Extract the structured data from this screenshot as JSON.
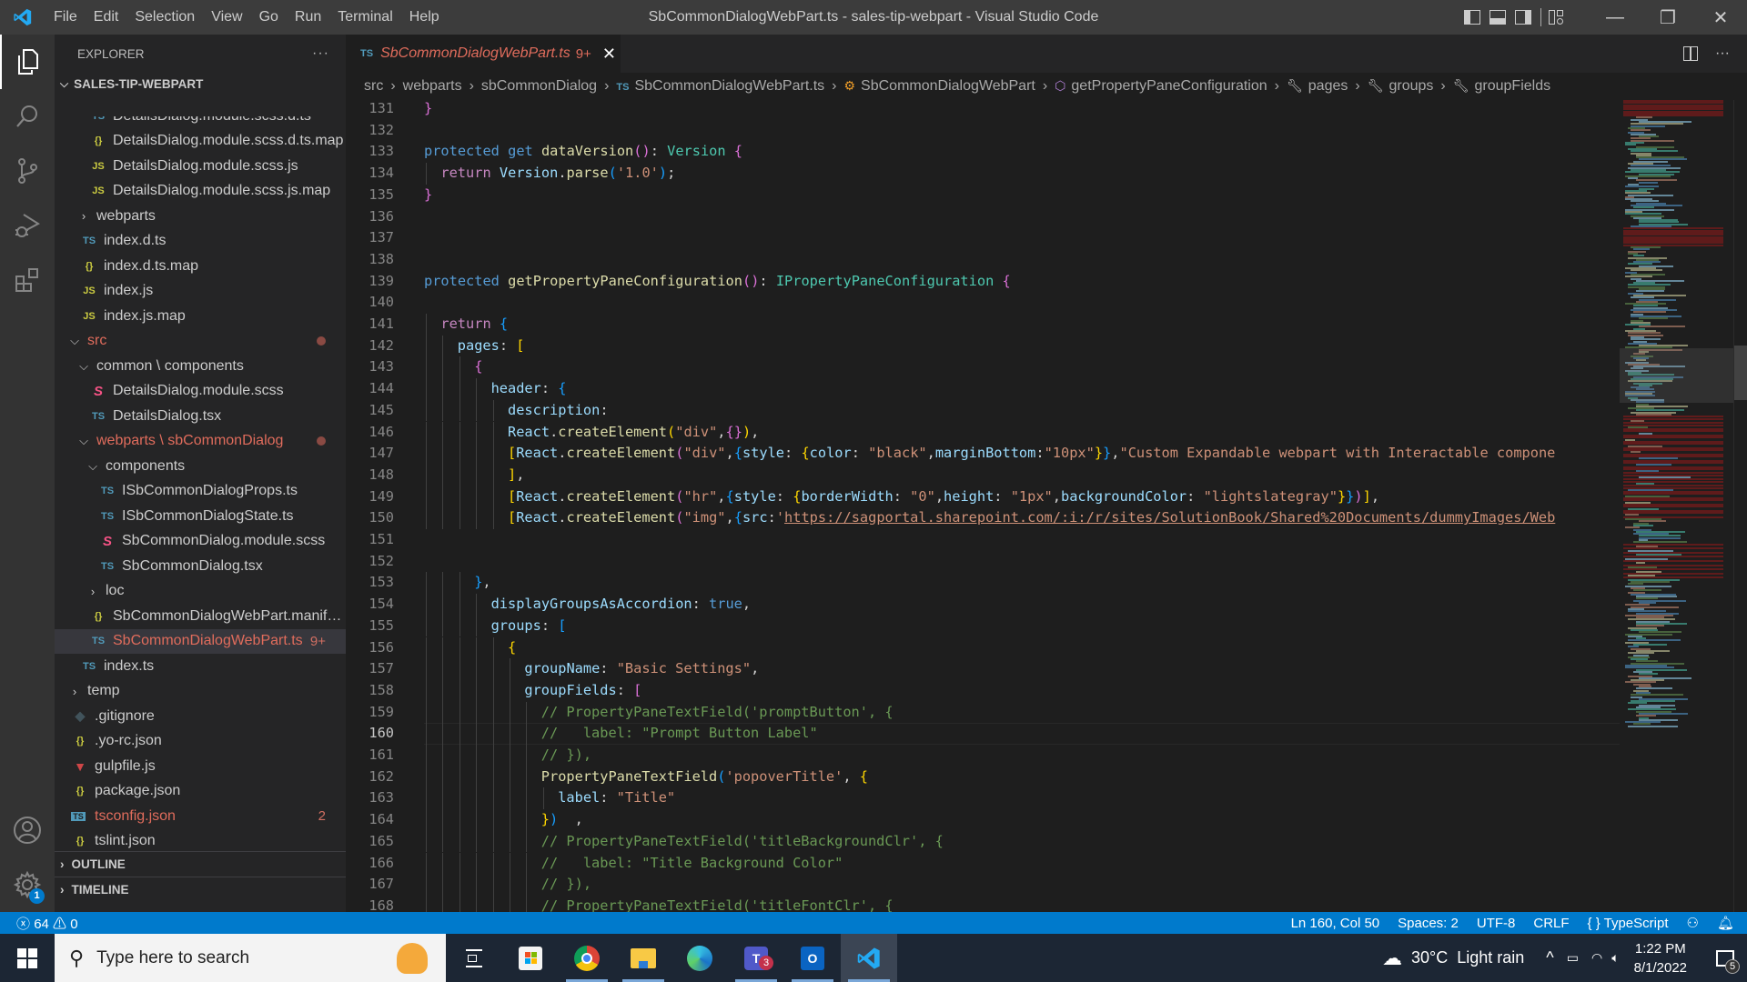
{
  "titlebar": {
    "menu": [
      "File",
      "Edit",
      "Selection",
      "View",
      "Go",
      "Run",
      "Terminal",
      "Help"
    ],
    "title": "SbCommonDialogWebPart.ts - sales-tip-webpart - Visual Studio Code",
    "controls": {
      "minimize": "—",
      "restore": "❐",
      "close": "✕"
    }
  },
  "activity_bar": {
    "items": [
      "explorer-icon",
      "search-icon",
      "source-control-icon",
      "run-debug-icon",
      "extensions-icon"
    ],
    "bottom": [
      "accounts-icon",
      "manage-gear-icon"
    ],
    "manage_badge": "1"
  },
  "sidebar": {
    "header": "EXPLORER",
    "more": "···",
    "project": "SALES-TIP-WEBPART",
    "tree": [
      {
        "label": "DetailsDialog.module.scss.d.ts",
        "icon": "TS",
        "kind": "ts",
        "depth": 3,
        "partial": true
      },
      {
        "label": "DetailsDialog.module.scss.d.ts.map",
        "icon": "{}",
        "kind": "json",
        "depth": 3
      },
      {
        "label": "DetailsDialog.module.scss.js",
        "icon": "JS",
        "kind": "js",
        "depth": 3
      },
      {
        "label": "DetailsDialog.module.scss.js.map",
        "icon": "JS",
        "kind": "js",
        "depth": 3
      },
      {
        "label": "webparts",
        "folder": "closed",
        "depth": 2
      },
      {
        "label": "index.d.ts",
        "icon": "TS",
        "kind": "ts",
        "depth": 2
      },
      {
        "label": "index.d.ts.map",
        "icon": "{}",
        "kind": "json",
        "depth": 2
      },
      {
        "label": "index.js",
        "icon": "JS",
        "kind": "js",
        "depth": 2
      },
      {
        "label": "index.js.map",
        "icon": "JS",
        "kind": "js",
        "depth": 2
      },
      {
        "label": "src",
        "folder": "open",
        "depth": 1,
        "modified": true,
        "dot": true
      },
      {
        "label": "common \\ components",
        "folder": "open",
        "depth": 2
      },
      {
        "label": "DetailsDialog.module.scss",
        "icon": "S",
        "kind": "scss",
        "depth": 3
      },
      {
        "label": "DetailsDialog.tsx",
        "icon": "TS",
        "kind": "ts",
        "depth": 3
      },
      {
        "label": "webparts \\ sbCommonDialog",
        "folder": "open",
        "depth": 2,
        "modified": true,
        "dot": true
      },
      {
        "label": "components",
        "folder": "open",
        "depth": 3
      },
      {
        "label": "ISbCommonDialogProps.ts",
        "icon": "TS",
        "kind": "ts",
        "depth": 4
      },
      {
        "label": "ISbCommonDialogState.ts",
        "icon": "TS",
        "kind": "ts",
        "depth": 4
      },
      {
        "label": "SbCommonDialog.module.scss",
        "icon": "S",
        "kind": "scss",
        "depth": 4
      },
      {
        "label": "SbCommonDialog.tsx",
        "icon": "TS",
        "kind": "ts",
        "depth": 4
      },
      {
        "label": "loc",
        "folder": "closed",
        "depth": 3
      },
      {
        "label": "SbCommonDialogWebPart.manife...",
        "icon": "{}",
        "kind": "json",
        "depth": 3
      },
      {
        "label": "SbCommonDialogWebPart.ts",
        "icon": "TS",
        "kind": "ts",
        "depth": 3,
        "modified": true,
        "selected": true,
        "badge": "9+"
      },
      {
        "label": "index.ts",
        "icon": "TS",
        "kind": "ts",
        "depth": 2
      },
      {
        "label": "temp",
        "folder": "closed",
        "depth": 1
      },
      {
        "label": ".gitignore",
        "icon": "◆",
        "kind": "git",
        "depth": 1
      },
      {
        "label": ".yo-rc.json",
        "icon": "{}",
        "kind": "json",
        "depth": 1
      },
      {
        "label": "gulpfile.js",
        "icon": "▼",
        "kind": "gulp",
        "depth": 1
      },
      {
        "label": "package.json",
        "icon": "{}",
        "kind": "json",
        "depth": 1
      },
      {
        "label": "tsconfig.json",
        "icon": "TS",
        "kind": "tsconfig",
        "depth": 1,
        "modified": true,
        "badge": "2"
      },
      {
        "label": "tslint.json",
        "icon": "{}",
        "kind": "json",
        "depth": 1
      }
    ],
    "sections": [
      "OUTLINE",
      "TIMELINE"
    ]
  },
  "tabs": [
    {
      "icon": "TS",
      "label": "SbCommonDialogWebPart.ts",
      "problems": "9+",
      "close": "✕",
      "active": true
    }
  ],
  "breadcrumb": [
    {
      "label": "src"
    },
    {
      "label": "webparts"
    },
    {
      "label": "sbCommonDialog"
    },
    {
      "label": "SbCommonDialogWebPart.ts",
      "icon": "TS"
    },
    {
      "label": "SbCommonDialogWebPart",
      "icon": "class-icon"
    },
    {
      "label": "getPropertyPaneConfiguration",
      "icon": "method-icon"
    },
    {
      "label": "pages",
      "icon": "property-icon"
    },
    {
      "label": "groups",
      "icon": "property-icon"
    },
    {
      "label": "groupFields",
      "icon": "property-icon"
    }
  ],
  "editor": {
    "current_line": 160,
    "lines": [
      {
        "n": "131",
        "indent": 1,
        "tokens": [
          [
            "b1",
            "}"
          ]
        ]
      },
      {
        "n": "132",
        "indent": 0,
        "tokens": []
      },
      {
        "n": "133",
        "indent": 1,
        "tokens": [
          [
            "kw",
            "protected "
          ],
          [
            "kw",
            "get "
          ],
          [
            "fn",
            "dataVersion"
          ],
          [
            "b1",
            "()"
          ],
          [
            "d",
            ": "
          ],
          [
            "ty",
            "Version "
          ],
          [
            "b1",
            "{"
          ]
        ]
      },
      {
        "n": "134",
        "indent": 2,
        "tokens": [
          [
            "kw2",
            "return "
          ],
          [
            "pr",
            "Version"
          ],
          [
            "d",
            "."
          ],
          [
            "fn",
            "parse"
          ],
          [
            "b2",
            "("
          ],
          [
            "st",
            "'1.0'"
          ],
          [
            "b2",
            ")"
          ],
          [
            "d",
            ";"
          ]
        ]
      },
      {
        "n": "135",
        "indent": 1,
        "tokens": [
          [
            "b1",
            "}"
          ]
        ]
      },
      {
        "n": "136",
        "indent": 0,
        "tokens": []
      },
      {
        "n": "137",
        "indent": 0,
        "tokens": []
      },
      {
        "n": "138",
        "indent": 0,
        "tokens": []
      },
      {
        "n": "139",
        "indent": 1,
        "tokens": [
          [
            "kw",
            "protected "
          ],
          [
            "fn",
            "getPropertyPaneConfiguration"
          ],
          [
            "b1",
            "()"
          ],
          [
            "d",
            ": "
          ],
          [
            "ty",
            "IPropertyPaneConfiguration "
          ],
          [
            "b1",
            "{"
          ]
        ]
      },
      {
        "n": "140",
        "indent": 0,
        "tokens": []
      },
      {
        "n": "141",
        "indent": 2,
        "tokens": [
          [
            "kw2",
            "return "
          ],
          [
            "b2",
            "{"
          ]
        ]
      },
      {
        "n": "142",
        "indent": 3,
        "tokens": [
          [
            "pr",
            "pages"
          ],
          [
            "d",
            ": "
          ],
          [
            "b3",
            "["
          ]
        ]
      },
      {
        "n": "143",
        "indent": 4,
        "tokens": [
          [
            "b1",
            "{"
          ]
        ]
      },
      {
        "n": "144",
        "indent": 5,
        "tokens": [
          [
            "pr",
            "header"
          ],
          [
            "d",
            ": "
          ],
          [
            "b2",
            "{"
          ]
        ]
      },
      {
        "n": "145",
        "indent": 6,
        "tokens": [
          [
            "pr",
            "description"
          ],
          [
            "d",
            ":"
          ]
        ]
      },
      {
        "n": "146",
        "indent": 6,
        "tokens": [
          [
            "pr",
            "React"
          ],
          [
            "d",
            "."
          ],
          [
            "fn",
            "createElement"
          ],
          [
            "b3",
            "("
          ],
          [
            "st",
            "\"div\""
          ],
          [
            "d",
            ","
          ],
          [
            "b1",
            "{}"
          ],
          [
            "b3",
            ")"
          ],
          [
            "d",
            ","
          ]
        ]
      },
      {
        "n": "147",
        "indent": 6,
        "tokens": [
          [
            "b3",
            "["
          ],
          [
            "pr",
            "React"
          ],
          [
            "d",
            "."
          ],
          [
            "fn",
            "createElement"
          ],
          [
            "b1",
            "("
          ],
          [
            "st",
            "\"div\""
          ],
          [
            "d",
            ","
          ],
          [
            "b2",
            "{"
          ],
          [
            "pr",
            "style"
          ],
          [
            "d",
            ": "
          ],
          [
            "b3",
            "{"
          ],
          [
            "pr",
            "color"
          ],
          [
            "d",
            ": "
          ],
          [
            "st",
            "\"black\""
          ],
          [
            "d",
            ","
          ],
          [
            "pr",
            "marginBottom"
          ],
          [
            "d",
            ":"
          ],
          [
            "st",
            "\"10px\""
          ],
          [
            "b3",
            "}"
          ],
          [
            "b2",
            "}"
          ],
          [
            "d",
            ","
          ],
          [
            "st",
            "\"Custom Expandable webpart with Interactable compone"
          ]
        ]
      },
      {
        "n": "148",
        "indent": 6,
        "tokens": [
          [
            "b3",
            "]"
          ],
          [
            "d",
            ","
          ]
        ]
      },
      {
        "n": "149",
        "indent": 6,
        "tokens": [
          [
            "b3",
            "["
          ],
          [
            "pr",
            "React"
          ],
          [
            "d",
            "."
          ],
          [
            "fn",
            "createElement"
          ],
          [
            "b1",
            "("
          ],
          [
            "st",
            "\"hr\""
          ],
          [
            "d",
            ","
          ],
          [
            "b2",
            "{"
          ],
          [
            "pr",
            "style"
          ],
          [
            "d",
            ": "
          ],
          [
            "b3",
            "{"
          ],
          [
            "pr",
            "borderWidth"
          ],
          [
            "d",
            ": "
          ],
          [
            "st",
            "\"0\""
          ],
          [
            "d",
            ","
          ],
          [
            "pr",
            "height"
          ],
          [
            "d",
            ": "
          ],
          [
            "st",
            "\"1px\""
          ],
          [
            "d",
            ","
          ],
          [
            "pr",
            "backgroundColor"
          ],
          [
            "d",
            ": "
          ],
          [
            "st",
            "\"lightslategray\""
          ],
          [
            "b3",
            "}"
          ],
          [
            "b2",
            "}"
          ],
          [
            "b1",
            ")"
          ],
          [
            "b3",
            "]"
          ],
          [
            "d",
            ","
          ]
        ]
      },
      {
        "n": "150",
        "indent": 6,
        "tokens": [
          [
            "b3",
            "["
          ],
          [
            "pr",
            "React"
          ],
          [
            "d",
            "."
          ],
          [
            "fn",
            "createElement"
          ],
          [
            "b1",
            "("
          ],
          [
            "st",
            "\"img\""
          ],
          [
            "d",
            ","
          ],
          [
            "b2",
            "{"
          ],
          [
            "pr",
            "src"
          ],
          [
            "d",
            ":"
          ],
          [
            "st",
            "'"
          ],
          [
            "url",
            "https://sagportal.sharepoint.com/:i:/r/sites/SolutionBook/Shared%20Documents/dummyImages/Web"
          ]
        ]
      },
      {
        "n": "151",
        "indent": 0,
        "tokens": []
      },
      {
        "n": "152",
        "indent": 0,
        "tokens": []
      },
      {
        "n": "153",
        "indent": 4,
        "tokens": [
          [
            "b2",
            "}"
          ],
          [
            "d",
            ","
          ]
        ]
      },
      {
        "n": "154",
        "indent": 5,
        "tokens": [
          [
            "pr",
            "displayGroupsAsAccordion"
          ],
          [
            "d",
            ": "
          ],
          [
            "bool",
            "true"
          ],
          [
            "d",
            ","
          ]
        ]
      },
      {
        "n": "155",
        "indent": 5,
        "tokens": [
          [
            "pr",
            "groups"
          ],
          [
            "d",
            ": "
          ],
          [
            "b2",
            "["
          ]
        ]
      },
      {
        "n": "156",
        "indent": 6,
        "tokens": [
          [
            "b3",
            "{"
          ]
        ]
      },
      {
        "n": "157",
        "indent": 7,
        "tokens": [
          [
            "pr",
            "groupName"
          ],
          [
            "d",
            ": "
          ],
          [
            "st",
            "\"Basic Settings\""
          ],
          [
            "d",
            ","
          ]
        ]
      },
      {
        "n": "158",
        "indent": 7,
        "tokens": [
          [
            "pr",
            "groupFields"
          ],
          [
            "d",
            ": "
          ],
          [
            "b1",
            "["
          ]
        ]
      },
      {
        "n": "159",
        "indent": 8,
        "tokens": [
          [
            "cm",
            "// PropertyPaneTextField('promptButton', {"
          ]
        ]
      },
      {
        "n": "160",
        "indent": 8,
        "tokens": [
          [
            "cm",
            "//   label: \"Prompt Button Label\""
          ]
        ]
      },
      {
        "n": "161",
        "indent": 8,
        "tokens": [
          [
            "cm",
            "// }),"
          ]
        ]
      },
      {
        "n": "162",
        "indent": 8,
        "tokens": [
          [
            "fn",
            "PropertyPaneTextField"
          ],
          [
            "b2",
            "("
          ],
          [
            "st",
            "'popoverTitle'"
          ],
          [
            "d",
            ", "
          ],
          [
            "b3",
            "{"
          ]
        ]
      },
      {
        "n": "163",
        "indent": 9,
        "tokens": [
          [
            "pr",
            "label"
          ],
          [
            "d",
            ": "
          ],
          [
            "st",
            "\"Title\""
          ]
        ]
      },
      {
        "n": "164",
        "indent": 8,
        "tokens": [
          [
            "b3",
            "}"
          ],
          [
            "b2",
            ")"
          ],
          [
            "d",
            "  ,"
          ]
        ]
      },
      {
        "n": "165",
        "indent": 8,
        "tokens": [
          [
            "cm",
            "// PropertyPaneTextField('titleBackgroundClr', {"
          ]
        ]
      },
      {
        "n": "166",
        "indent": 8,
        "tokens": [
          [
            "cm",
            "//   label: \"Title Background Color\""
          ]
        ]
      },
      {
        "n": "167",
        "indent": 8,
        "tokens": [
          [
            "cm",
            "// }),"
          ]
        ]
      },
      {
        "n": "168",
        "indent": 8,
        "tokens": [
          [
            "cm",
            "// PropertyPaneTextField('titleFontClr', {"
          ]
        ]
      }
    ]
  },
  "statusbar": {
    "errors": "64",
    "warnings": "0",
    "position": "Ln 160, Col 50",
    "spaces": "Spaces: 2",
    "encoding": "UTF-8",
    "eol": "CRLF",
    "language": "TypeScript",
    "language_icon": "{ }"
  },
  "taskbar": {
    "search_placeholder": "Type here to search",
    "apps": [
      "task-view-icon",
      "microsoft-store-icon",
      "chrome-icon",
      "file-explorer-icon",
      "edge-icon",
      "teams-icon",
      "outlook-icon",
      "vscode-icon"
    ],
    "teams_badge": "3",
    "weather": "30°C  Light rain",
    "time": "1:22 PM",
    "date": "8/1/2022",
    "notifications": "5"
  },
  "colors": {
    "accent": "#007acc",
    "modified": "#e06c5c",
    "titlebar": "#3c3c3c",
    "sidebar": "#252526",
    "editor": "#1e1e1e"
  }
}
